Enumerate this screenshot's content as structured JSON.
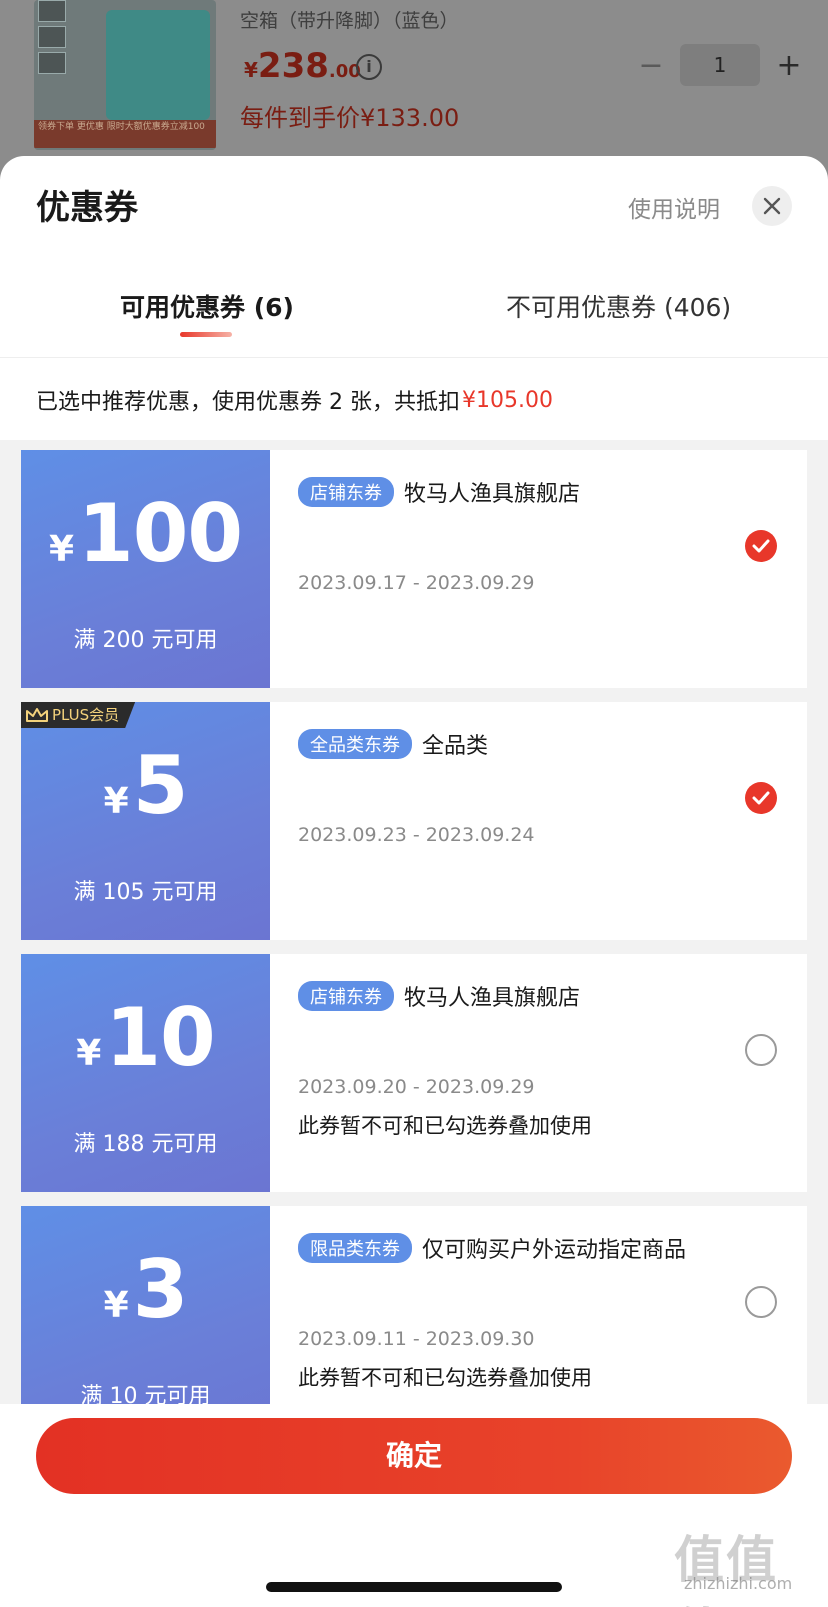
{
  "product": {
    "title": "空箱（带升降脚）（蓝色）",
    "price_symbol": "¥",
    "price_int": "238",
    "price_dec": ".00",
    "final_price": "每件到手价¥133.00",
    "quantity": "1",
    "thumb_tag": "领券下单 更优惠 限时大额优惠券立减100"
  },
  "sheet": {
    "title": "优惠券",
    "help": "使用说明"
  },
  "tabs": {
    "available": "可用优惠券 (6)",
    "unavailable": "不可用优惠券 (406)"
  },
  "summary": {
    "text": "已选中推荐优惠，使用优惠券 2 张，共抵扣",
    "amount": "¥105.00"
  },
  "coupons": [
    {
      "yen": "¥",
      "amount": "100",
      "condition": "满 200 元可用",
      "type": "店铺东券",
      "scope": "牧马人渔具旗舰店",
      "dates": "2023.09.17 - 2023.09.29",
      "note": "",
      "selected": true
    },
    {
      "badge": "PLUS会员",
      "yen": "¥",
      "amount": "5",
      "condition": "满 105 元可用",
      "type": "全品类东券",
      "scope": "全品类",
      "dates": "2023.09.23 - 2023.09.24",
      "note": "",
      "selected": true
    },
    {
      "yen": "¥",
      "amount": "10",
      "condition": "满 188 元可用",
      "type": "店铺东券",
      "scope": "牧马人渔具旗舰店",
      "dates": "2023.09.20 - 2023.09.29",
      "note": "此券暂不可和已勾选券叠加使用",
      "selected": false
    },
    {
      "yen": "¥",
      "amount": "3",
      "condition": "满 10 元可用",
      "type": "限品类东券",
      "scope": "仅可购买户外运动指定商品",
      "dates": "2023.09.11 - 2023.09.30",
      "note": "此券暂不可和已勾选券叠加使用",
      "selected": false
    }
  ],
  "confirm": "确定",
  "watermark": {
    "text": "值值值",
    "url": "zhizhizhi.com"
  },
  "colors": {
    "accent": "#e8372a",
    "coupon_blue": "#5f8fe6"
  },
  "icons": [
    "close-icon",
    "info-icon",
    "minus-icon",
    "plus-icon",
    "checkmark-icon",
    "crown-icon"
  ]
}
